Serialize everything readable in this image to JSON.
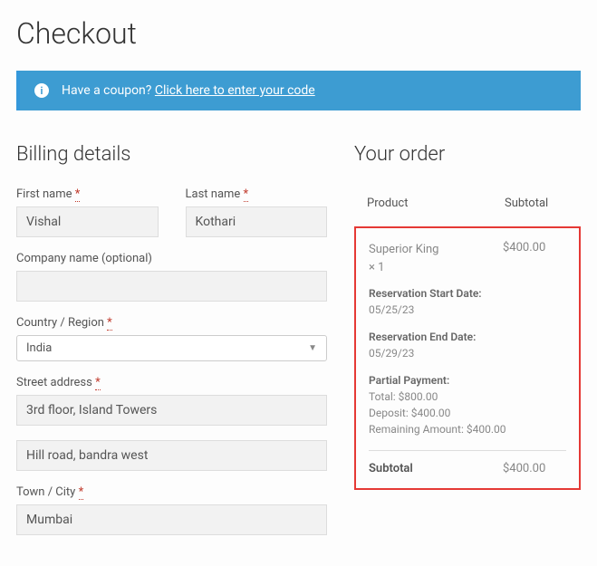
{
  "page": {
    "title": "Checkout"
  },
  "coupon": {
    "text": "Have a coupon?",
    "link": "Click here to enter your code"
  },
  "billing": {
    "heading": "Billing details",
    "first_name_label": "First name",
    "first_name": "Vishal",
    "last_name_label": "Last name",
    "last_name": "Kothari",
    "company_label": "Company name (optional)",
    "company": "",
    "country_label": "Country / Region",
    "country": "India",
    "street_label": "Street address",
    "street1": "3rd floor, Island Towers",
    "street2": "Hill road, bandra west",
    "city_label": "Town / City",
    "city": "Mumbai",
    "required_mark": "*"
  },
  "order": {
    "heading": "Your order",
    "col_product": "Product",
    "col_subtotal": "Subtotal",
    "item": {
      "name": "Superior King",
      "qty": "× 1",
      "price": "$400.00"
    },
    "res_start_label": "Reservation Start Date:",
    "res_start": "05/25/23",
    "res_end_label": "Reservation End Date:",
    "res_end": "05/29/23",
    "partial_label": "Partial Payment:",
    "total_line": "Total: $800.00",
    "deposit_line": "Deposit: $400.00",
    "remaining_line": "Remaining Amount: $400.00",
    "subtotal_label": "Subtotal",
    "subtotal_value": "$400.00"
  }
}
